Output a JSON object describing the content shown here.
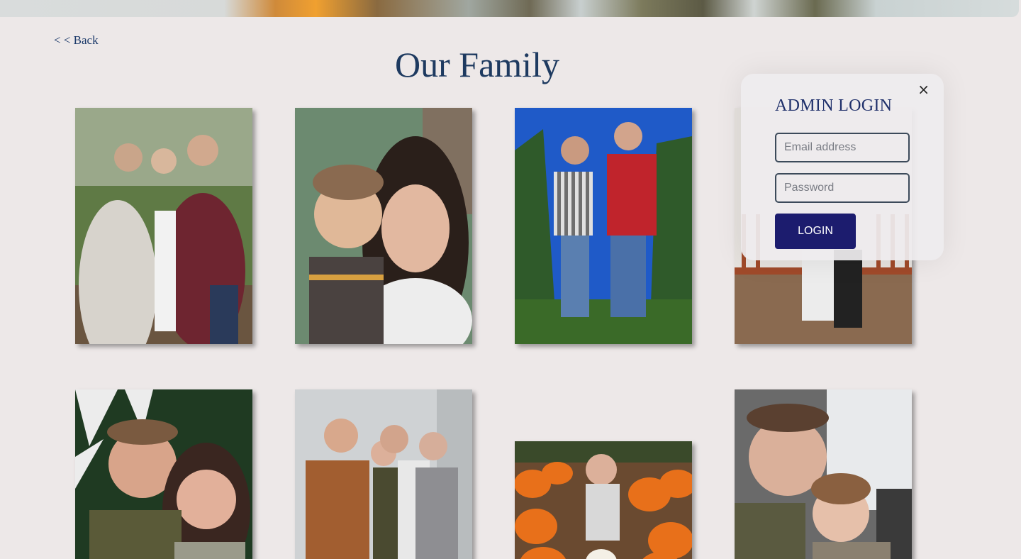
{
  "nav": {
    "back_label": "< < Back"
  },
  "page": {
    "title": "Our Family"
  },
  "modal": {
    "title": "ADMIN LOGIN",
    "close_label": "×",
    "email_placeholder": "Email address",
    "password_placeholder": "Password",
    "login_label": "LOGIN"
  },
  "colors": {
    "title": "#1e3a60",
    "button": "#1c1c6e",
    "background": "#ede8e8"
  }
}
